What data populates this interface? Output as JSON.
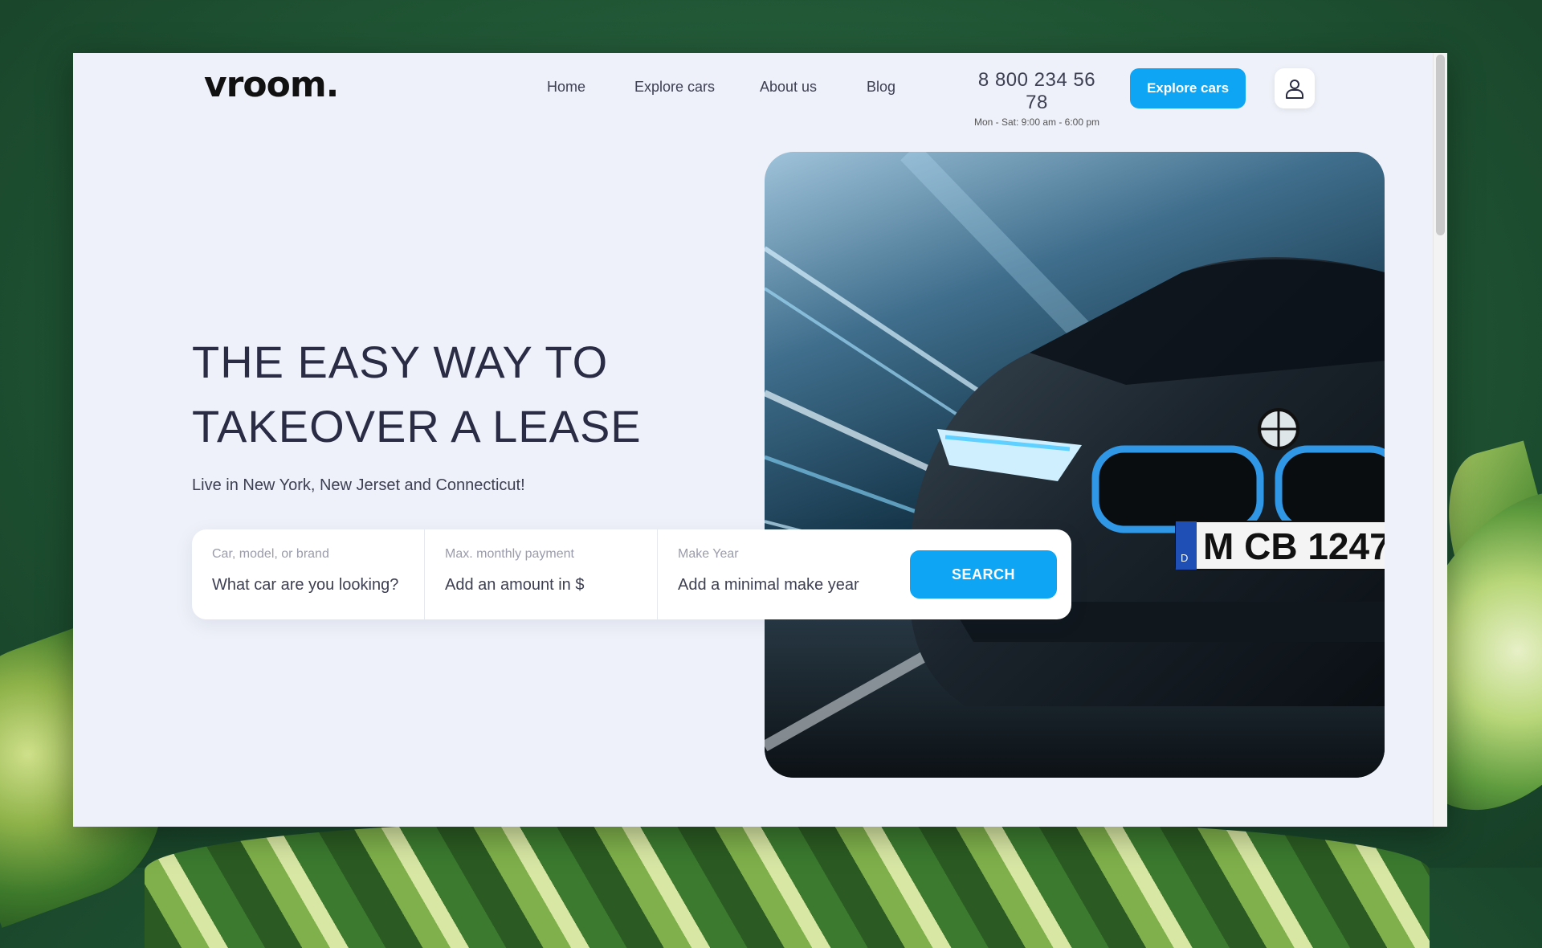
{
  "brand": {
    "logo_text": "vroom."
  },
  "nav": {
    "items": [
      {
        "label": "Home"
      },
      {
        "label": "Explore cars"
      },
      {
        "label": "About us"
      },
      {
        "label": "Blog"
      }
    ]
  },
  "contact": {
    "phone": "8 800 234 56 78",
    "hours": "Mon - Sat: 9:00 am - 6:00 pm"
  },
  "header": {
    "cta_label": "Explore cars",
    "user_icon": "user-icon"
  },
  "hero": {
    "headline_line1": "THE EASY WAY TO",
    "headline_line2": "TAKEOVER A LEASE",
    "subtitle": "Live in New York, New Jerset and Connecticut!",
    "plate_text": "M CB 1247",
    "plate_country": "D"
  },
  "search": {
    "fields": [
      {
        "label": "Car, model, or brand",
        "placeholder": "What car are you looking?"
      },
      {
        "label": "Max. monthly payment",
        "placeholder": "Add an amount in $"
      },
      {
        "label": "Make Year",
        "placeholder": "Add a minimal make year"
      }
    ],
    "button_label": "SEARCH"
  },
  "colors": {
    "accent": "#0ea5f5",
    "page_bg": "#eef1f9",
    "text_dark": "#2a2c45"
  }
}
